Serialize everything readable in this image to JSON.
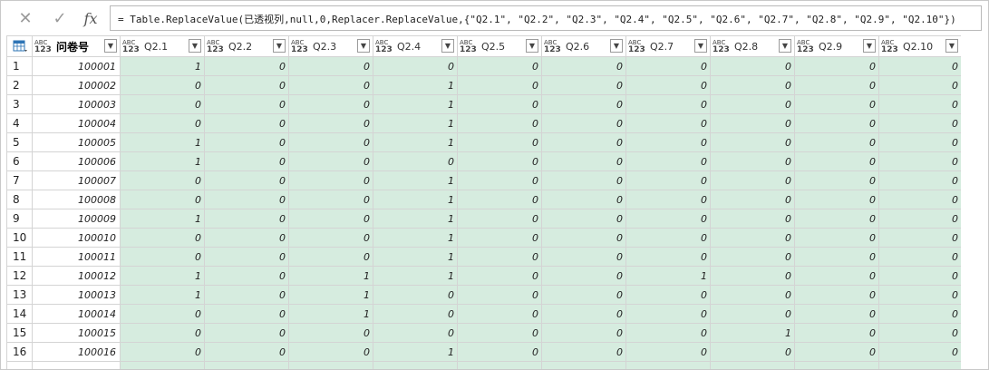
{
  "formula_bar": {
    "cancel_icon": "✕",
    "confirm_icon": "✓",
    "fx_label": "fx",
    "formula": "= Table.ReplaceValue(已透视列,null,0,Replacer.ReplaceValue,{\"Q2.1\", \"Q2.2\", \"Q2.3\", \"Q2.4\", \"Q2.5\", \"Q2.6\", \"Q2.7\", \"Q2.8\", \"Q2.9\", \"Q2.10\"})"
  },
  "table": {
    "type_icon_top": "ABC",
    "type_icon_bottom": "123",
    "columns": [
      "问卷号",
      "Q2.1",
      "Q2.2",
      "Q2.3",
      "Q2.4",
      "Q2.5",
      "Q2.6",
      "Q2.7",
      "Q2.8",
      "Q2.9",
      "Q2.10"
    ],
    "rows": [
      {
        "n": "1",
        "id": "100001",
        "v": [
          "1",
          "0",
          "0",
          "0",
          "0",
          "0",
          "0",
          "0",
          "0",
          "0"
        ]
      },
      {
        "n": "2",
        "id": "100002",
        "v": [
          "0",
          "0",
          "0",
          "1",
          "0",
          "0",
          "0",
          "0",
          "0",
          "0"
        ]
      },
      {
        "n": "3",
        "id": "100003",
        "v": [
          "0",
          "0",
          "0",
          "1",
          "0",
          "0",
          "0",
          "0",
          "0",
          "0"
        ]
      },
      {
        "n": "4",
        "id": "100004",
        "v": [
          "0",
          "0",
          "0",
          "1",
          "0",
          "0",
          "0",
          "0",
          "0",
          "0"
        ]
      },
      {
        "n": "5",
        "id": "100005",
        "v": [
          "1",
          "0",
          "0",
          "1",
          "0",
          "0",
          "0",
          "0",
          "0",
          "0"
        ]
      },
      {
        "n": "6",
        "id": "100006",
        "v": [
          "1",
          "0",
          "0",
          "0",
          "0",
          "0",
          "0",
          "0",
          "0",
          "0"
        ]
      },
      {
        "n": "7",
        "id": "100007",
        "v": [
          "0",
          "0",
          "0",
          "1",
          "0",
          "0",
          "0",
          "0",
          "0",
          "0"
        ]
      },
      {
        "n": "8",
        "id": "100008",
        "v": [
          "0",
          "0",
          "0",
          "1",
          "0",
          "0",
          "0",
          "0",
          "0",
          "0"
        ]
      },
      {
        "n": "9",
        "id": "100009",
        "v": [
          "1",
          "0",
          "0",
          "1",
          "0",
          "0",
          "0",
          "0",
          "0",
          "0"
        ]
      },
      {
        "n": "10",
        "id": "100010",
        "v": [
          "0",
          "0",
          "0",
          "1",
          "0",
          "0",
          "0",
          "0",
          "0",
          "0"
        ]
      },
      {
        "n": "11",
        "id": "100011",
        "v": [
          "0",
          "0",
          "0",
          "1",
          "0",
          "0",
          "0",
          "0",
          "0",
          "0"
        ]
      },
      {
        "n": "12",
        "id": "100012",
        "v": [
          "1",
          "0",
          "1",
          "1",
          "0",
          "0",
          "1",
          "0",
          "0",
          "0"
        ]
      },
      {
        "n": "13",
        "id": "100013",
        "v": [
          "1",
          "0",
          "1",
          "0",
          "0",
          "0",
          "0",
          "0",
          "0",
          "0"
        ]
      },
      {
        "n": "14",
        "id": "100014",
        "v": [
          "0",
          "0",
          "1",
          "0",
          "0",
          "0",
          "0",
          "0",
          "0",
          "0"
        ]
      },
      {
        "n": "15",
        "id": "100015",
        "v": [
          "0",
          "0",
          "0",
          "0",
          "0",
          "0",
          "0",
          "1",
          "0",
          "0"
        ]
      },
      {
        "n": "16",
        "id": "100016",
        "v": [
          "0",
          "0",
          "0",
          "1",
          "0",
          "0",
          "0",
          "0",
          "0",
          "0"
        ]
      }
    ]
  },
  "colors": {
    "value_cell_bg": "#d6ecdf",
    "grid_line": "#d4d4d4",
    "table_icon": "#2e75b6"
  }
}
